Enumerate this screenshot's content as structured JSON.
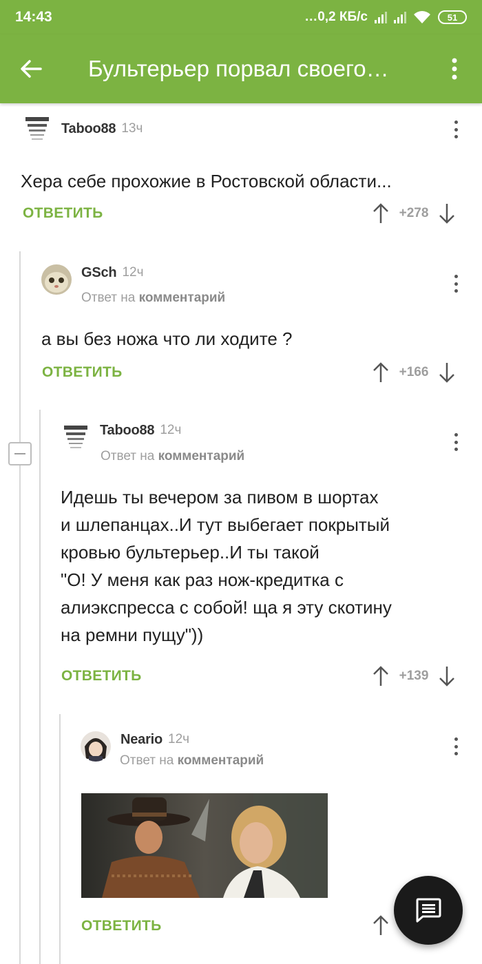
{
  "status_bar": {
    "time": "14:43",
    "network_speed": "…0,2 КБ/с",
    "battery": "51"
  },
  "app_bar": {
    "title": "Бультерьер порвал своего…"
  },
  "comments": [
    {
      "author": "Taboo88",
      "time": "13ч",
      "text": "Хера себе прохожие в Ростовской области...",
      "reply_label": "ОТВЕТИТЬ",
      "score": "+278"
    },
    {
      "author": "GSch",
      "time": "12ч",
      "reply_prefix": "Ответ на",
      "reply_target": "комментарий",
      "text": "а вы без ножа что ли ходите ?",
      "reply_label": "ОТВЕТИТЬ",
      "score": "+166"
    },
    {
      "author": "Taboo88",
      "time": "12ч",
      "reply_prefix": "Ответ на",
      "reply_target": "комментарий",
      "text_lines": [
        "Идешь ты вечером за пивом в шортах",
        "и шлепанцах..И тут выбегает покрытый",
        "кровью бультерьер..И ты такой",
        "\"О! У меня как раз нож-кредитка с",
        "алиэкспресса с собой! ща я эту скотину",
        "на ремни пущу\"))"
      ],
      "reply_label": "ОТВЕТИТЬ",
      "score": "+139"
    },
    {
      "author": "Neario",
      "time": "12ч",
      "reply_prefix": "Ответ на",
      "reply_target": "комментарий",
      "reply_label": "ОТВЕТИТЬ"
    }
  ],
  "colors": {
    "accent": "#7cb342",
    "muted": "#9e9e9e",
    "fab": "#1a1a1a"
  },
  "icons": [
    "back-arrow-icon",
    "more-vert-icon",
    "upvote-arrow-icon",
    "downvote-arrow-icon",
    "collapse-minus-icon",
    "comment-fab-icon",
    "wifi-icon",
    "signal-icon",
    "battery-icon"
  ]
}
